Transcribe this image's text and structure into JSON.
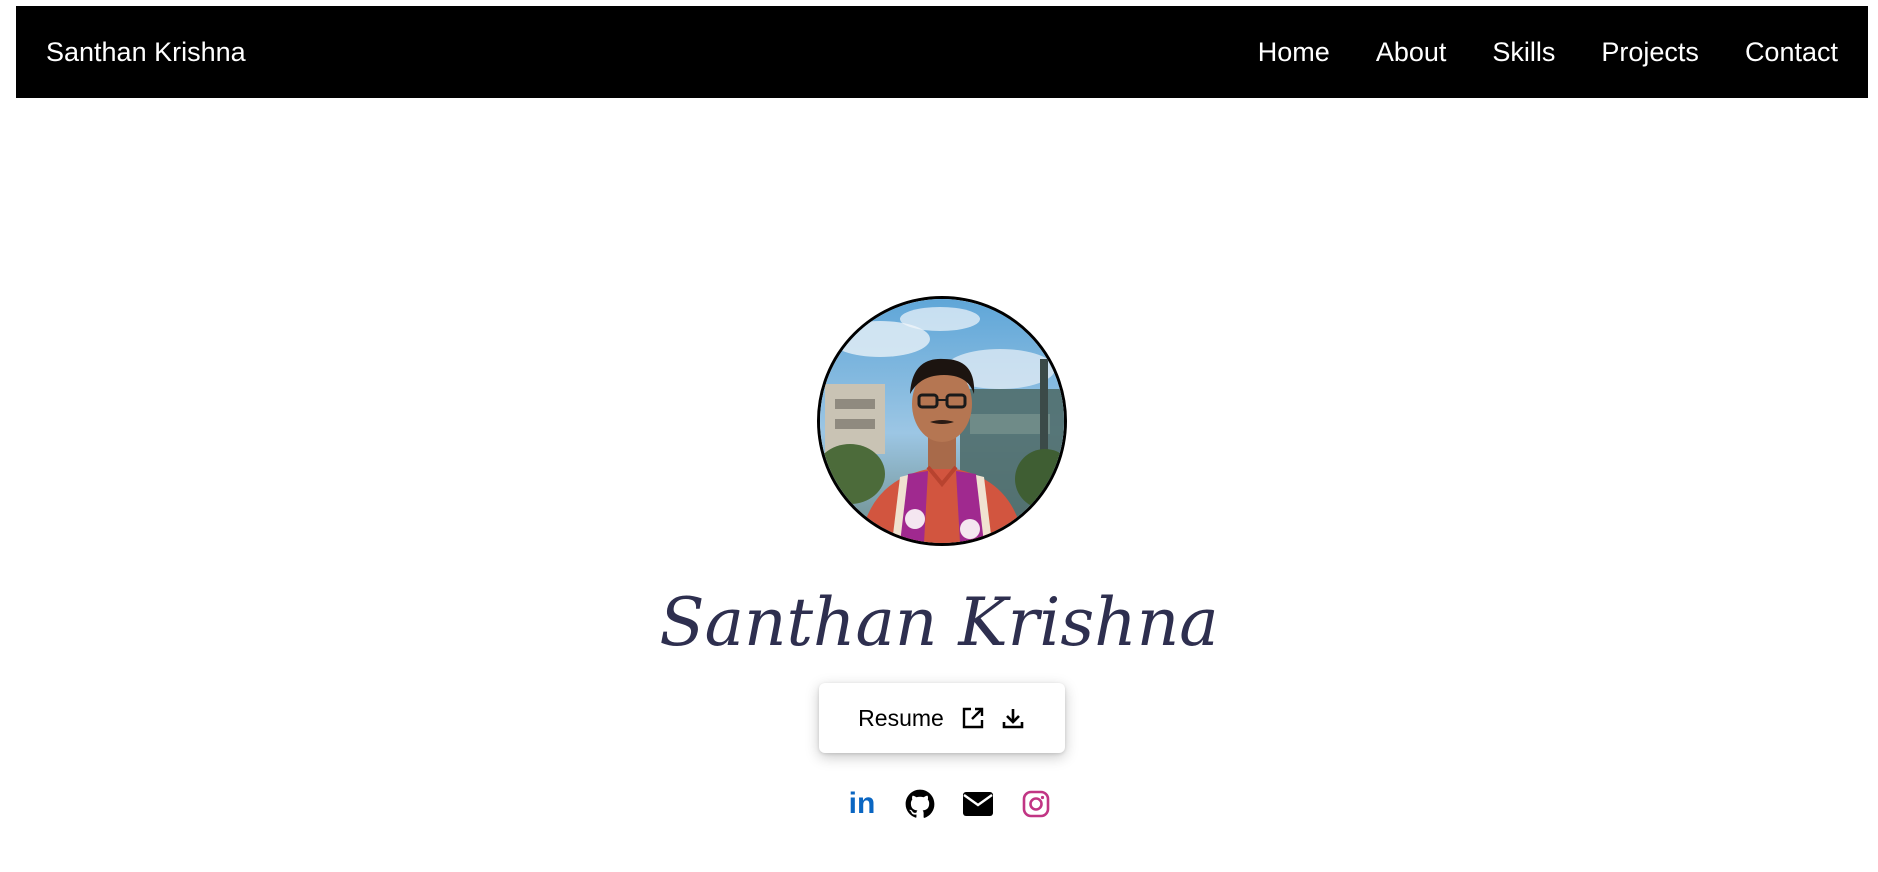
{
  "navbar": {
    "brand": "Santhan Krishna",
    "links": [
      "Home",
      "About",
      "Skills",
      "Projects",
      "Contact"
    ]
  },
  "hero": {
    "name": "Santhan Krishna",
    "resume_label": "Resume",
    "resume_icons": [
      "external-link-icon",
      "download-icon"
    ],
    "socials": [
      {
        "name": "linkedin-icon",
        "glyph": "in",
        "color": "#0a66c2"
      },
      {
        "name": "github-icon",
        "color": "#000000"
      },
      {
        "name": "mail-icon",
        "color": "#000000"
      },
      {
        "name": "instagram-icon",
        "color": "#c13584"
      }
    ]
  },
  "colors": {
    "navbar_bg": "#000000",
    "nav_text": "#ffffff",
    "name_text": "#2e2f4f",
    "linkedin": "#0a66c2",
    "instagram": "#c13584"
  }
}
